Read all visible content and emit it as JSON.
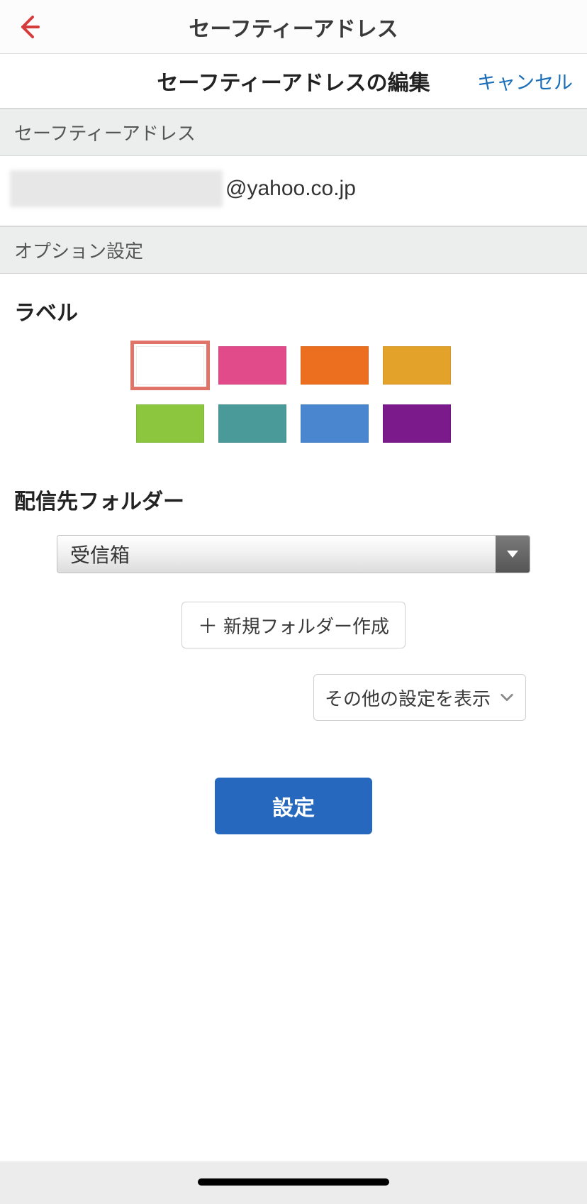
{
  "nav": {
    "title": "セーフティーアドレス"
  },
  "subheader": {
    "title": "セーフティーアドレスの編集",
    "cancel": "キャンセル"
  },
  "sections": {
    "safety_address": "セーフティーアドレス",
    "option_settings": "オプション設定"
  },
  "email": {
    "domain": "@yahoo.co.jp"
  },
  "label": {
    "title": "ラベル",
    "colors": [
      "#ffffff",
      "#e24b8a",
      "#eb6f1f",
      "#e3a32b",
      "#8cc63f",
      "#4b9a9a",
      "#4a86d0",
      "#7a1a8b"
    ],
    "selected_index": 0
  },
  "folder": {
    "title": "配信先フォルダー",
    "selected": "受信箱",
    "new_folder": "新規フォルダー作成"
  },
  "other_settings": "その他の設定を表示",
  "submit": "設定"
}
